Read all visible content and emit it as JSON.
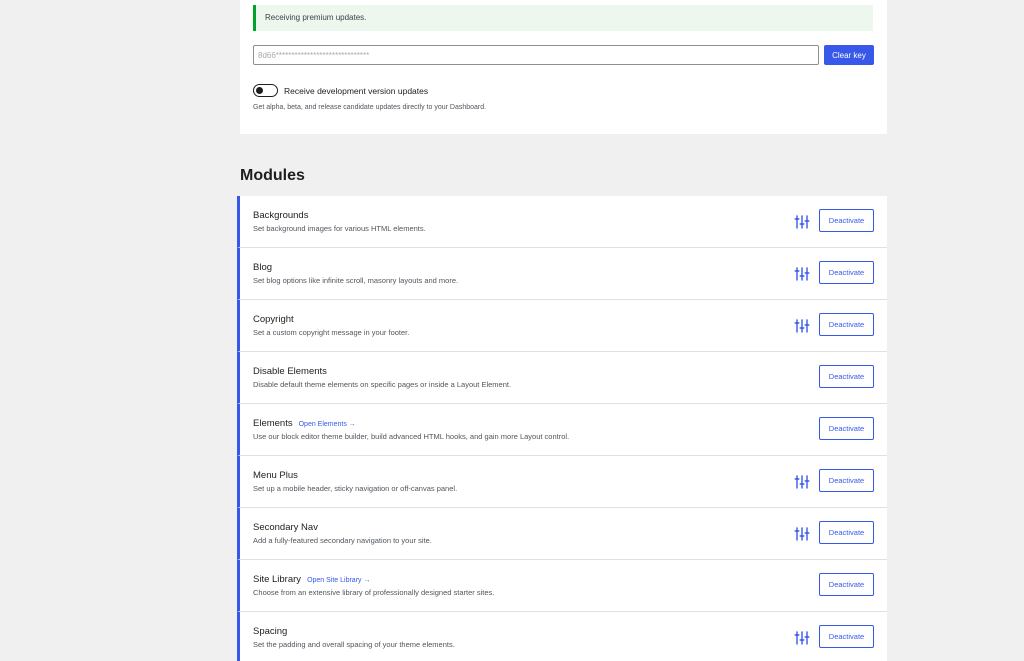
{
  "license": {
    "notice": "Receiving premium updates.",
    "key_value": "8d66******************************",
    "clear_key_label": "Clear key",
    "dev_toggle_label": "Receive development version updates",
    "dev_toggle_on": false,
    "dev_help": "Get alpha, beta, and release candidate updates directly to your Dashboard."
  },
  "modules": {
    "title": "Modules",
    "accent": "#3858e9",
    "items": [
      {
        "name": "Backgrounds",
        "link": "",
        "desc": "Set background images for various HTML elements.",
        "settings": true,
        "button": "Deactivate"
      },
      {
        "name": "Blog",
        "link": "",
        "desc": "Set blog options like infinite scroll, masonry layouts and more.",
        "settings": true,
        "button": "Deactivate"
      },
      {
        "name": "Copyright",
        "link": "",
        "desc": "Set a custom copyright message in your footer.",
        "settings": true,
        "button": "Deactivate"
      },
      {
        "name": "Disable Elements",
        "link": "",
        "desc": "Disable default theme elements on specific pages or inside a Layout Element.",
        "settings": false,
        "button": "Deactivate"
      },
      {
        "name": "Elements",
        "link": "Open Elements →",
        "desc": "Use our block editor theme builder, build advanced HTML hooks, and gain more Layout control.",
        "settings": false,
        "button": "Deactivate"
      },
      {
        "name": "Menu Plus",
        "link": "",
        "desc": "Set up a mobile header, sticky navigation or off-canvas panel.",
        "settings": true,
        "button": "Deactivate"
      },
      {
        "name": "Secondary Nav",
        "link": "",
        "desc": "Add a fully-featured secondary navigation to your site.",
        "settings": true,
        "button": "Deactivate"
      },
      {
        "name": "Site Library",
        "link": "Open Site Library →",
        "desc": "Choose from an extensive library of professionally designed starter sites.",
        "settings": false,
        "button": "Deactivate"
      },
      {
        "name": "Spacing",
        "link": "",
        "desc": "Set the padding and overall spacing of your theme elements.",
        "settings": true,
        "button": "Deactivate"
      }
    ]
  }
}
